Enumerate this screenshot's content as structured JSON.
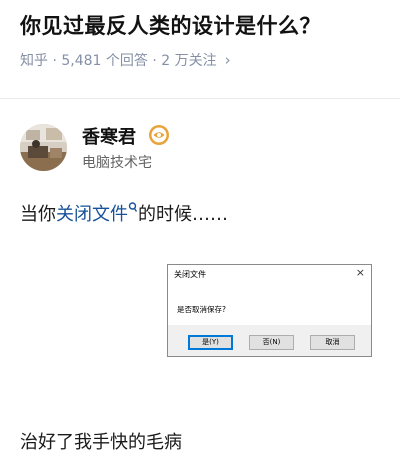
{
  "question": {
    "title": "你见过最反人类的设计是什么？",
    "meta": "知乎 · 5,481 个回答 · 2 万关注",
    "meta_chevron": "›"
  },
  "author": {
    "name": "香寒君",
    "bio": "电脑技术宅",
    "badge_icon": "eye-badge-icon",
    "badge_color": "#e8a33a"
  },
  "answer": {
    "line1_prefix": "当你",
    "line1_link": "关闭文件",
    "line1_suffix": "的时候……",
    "line2": "治好了我手快的毛病",
    "link_color": "#175199"
  },
  "dialog": {
    "title": "关闭文件",
    "close_glyph": "×",
    "message": "是否取消保存?",
    "buttons": {
      "yes": "是(Y)",
      "no": "否(N)",
      "cancel": "取消"
    }
  }
}
